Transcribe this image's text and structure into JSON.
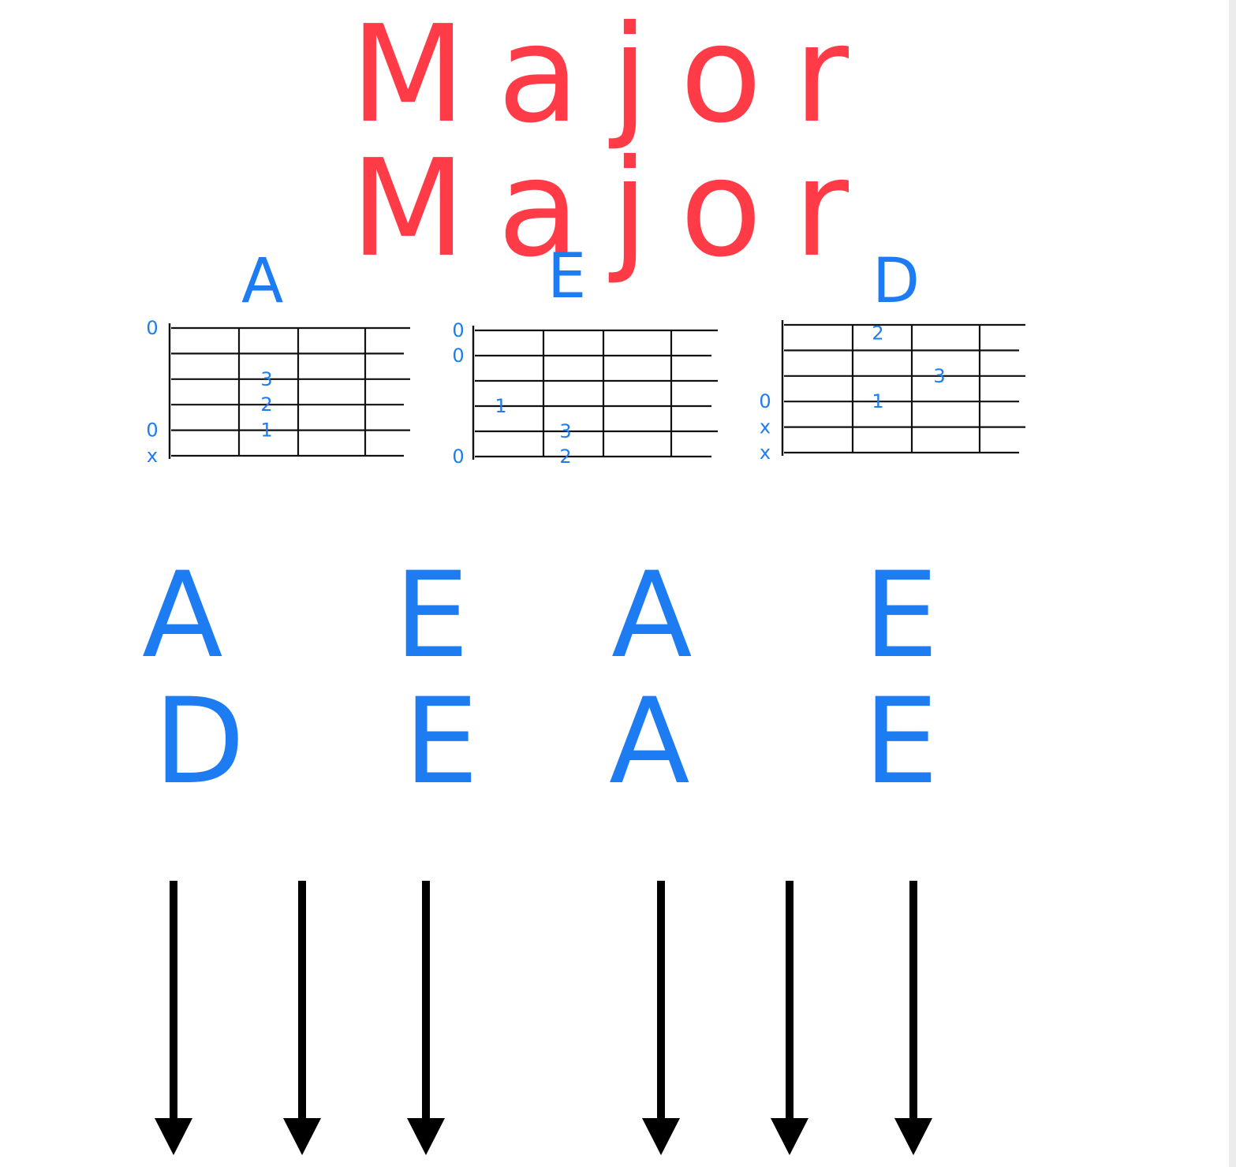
{
  "title": "Major Major",
  "colors": {
    "title": "#ff3b47",
    "chords": "#1e7cf2",
    "grid": "#111111",
    "arrows": "#000000"
  },
  "chord_diagrams": [
    {
      "name": "A",
      "string_marks": [
        "0",
        "",
        "",
        "",
        "0",
        "x"
      ],
      "fingers": [
        {
          "label": "3",
          "string": 2,
          "fret": 1
        },
        {
          "label": "2",
          "string": 3,
          "fret": 1
        },
        {
          "label": "1",
          "string": 4,
          "fret": 1
        }
      ]
    },
    {
      "name": "E",
      "string_marks": [
        "0",
        "0",
        "",
        "",
        "",
        "0"
      ],
      "fingers": [
        {
          "label": "1",
          "string": 3,
          "fret": 0
        },
        {
          "label": "3",
          "string": 4,
          "fret": 1
        },
        {
          "label": "2",
          "string": 5,
          "fret": 1
        }
      ]
    },
    {
      "name": "D",
      "string_marks": [
        "",
        "",
        "",
        "0",
        "x",
        "x"
      ],
      "fingers": [
        {
          "label": "2",
          "string": 1,
          "fret": 1
        },
        {
          "label": "3",
          "string": 2,
          "fret": 2
        },
        {
          "label": "1",
          "string": 3,
          "fret": 1
        }
      ]
    }
  ],
  "progression": [
    [
      "A",
      "E",
      "A",
      "E"
    ],
    [
      "D",
      "E",
      "A",
      "E"
    ]
  ],
  "strum_arrows": [
    "down",
    "down",
    "down",
    "down",
    "down",
    "down"
  ]
}
